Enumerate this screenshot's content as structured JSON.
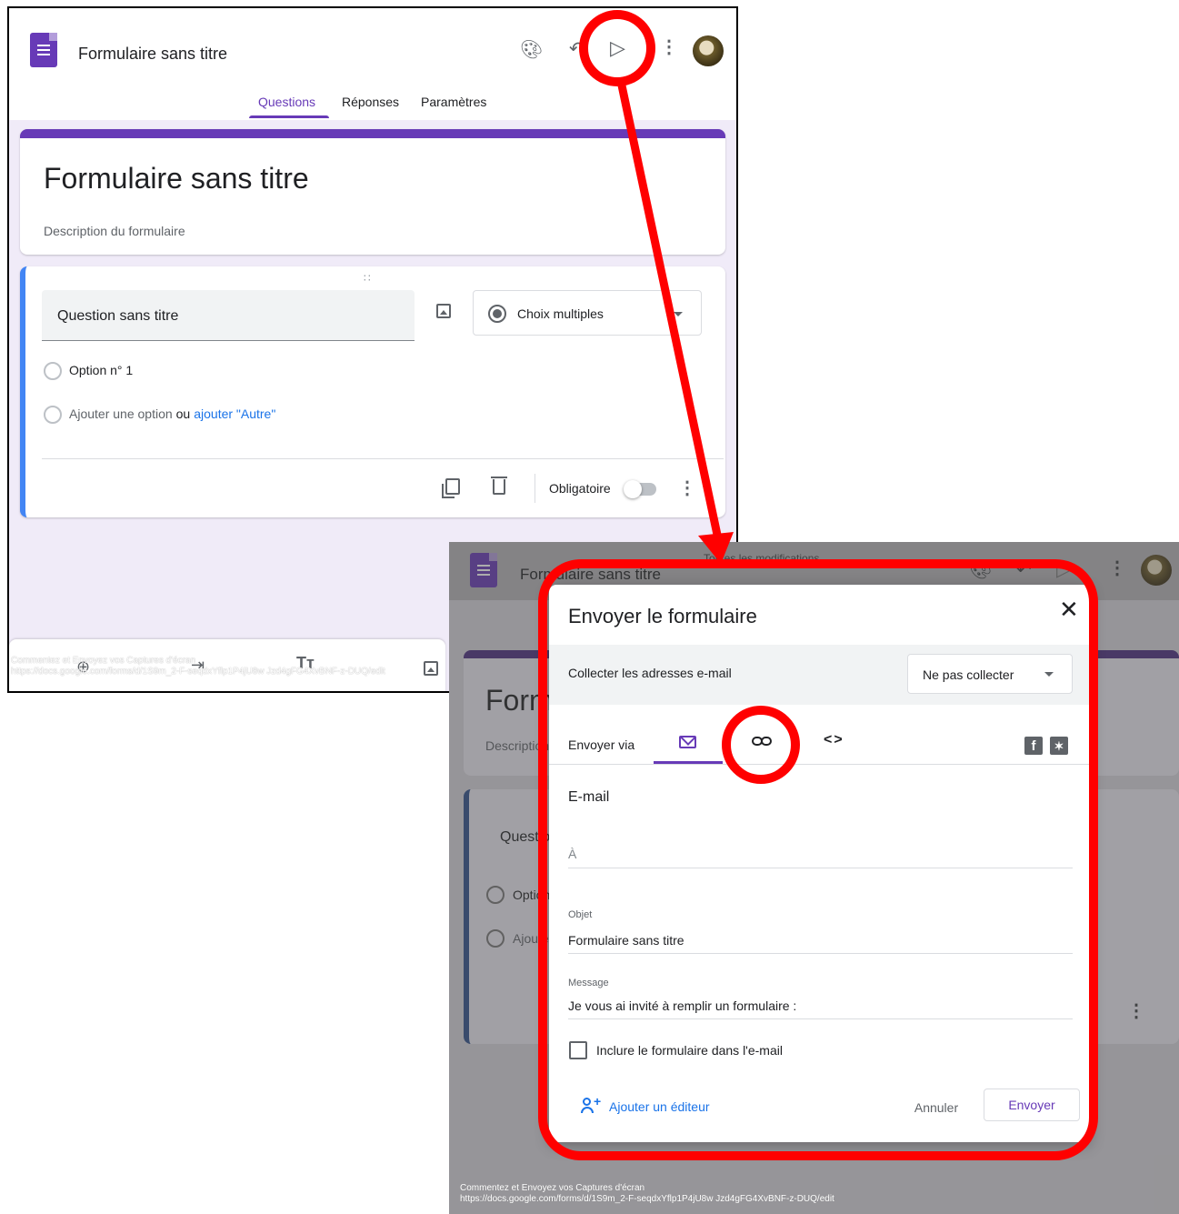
{
  "top_screen": {
    "app_title": "Formulaire sans titre",
    "tabs": [
      "Questions",
      "Réponses",
      "Paramètres"
    ],
    "form_title": "Formulaire sans titre",
    "form_description": "Description du formulaire",
    "question": {
      "title": "Question sans titre",
      "type": "Choix multiples",
      "option_1": "Option n° 1",
      "add_option": "Ajouter une option",
      "or": "ou",
      "add_other": "ajouter \"Autre\""
    },
    "required_label": "Obligatoire",
    "watermark_line1": "Commentez et Envoyez vos Captures d'écran",
    "watermark_line2": "https://docs.google.com/forms/d/1S9m_2-F-seqdxYflp1P4jU8w Jzd4gFG4XvBNF-z-DUQ/edit"
  },
  "bottom_screen": {
    "app_title": "Formulaire sans titre",
    "saved_status": "Toutes les modifications",
    "bg_title": "Formulaire sans titre",
    "bg_desc": "Description du formulaire",
    "bg_question": "Question sans titre",
    "bg_option": "Option n° 1",
    "bg_add_option": "Ajouter une option",
    "dialog": {
      "title": "Envoyer le formulaire",
      "collect_label": "Collecter les adresses e-mail",
      "collect_value": "Ne pas collecter",
      "send_via": "Envoyer via",
      "email_heading": "E-mail",
      "to_placeholder": "À",
      "subject_label": "Objet",
      "subject_value": "Formulaire sans titre",
      "message_label": "Message",
      "message_value": "Je vous ai invité à remplir un formulaire :",
      "include_label": "Inclure le formulaire dans l'e-mail",
      "add_editor": "Ajouter un éditeur",
      "cancel": "Annuler",
      "send": "Envoyer"
    },
    "watermark_line1": "Commentez et Envoyez vos Captures d'écran",
    "watermark_line2": "https://docs.google.com/forms/d/1S9m_2-F-seqdxYflp1P4jU8w Jzd4gFG4XvBNF-z-DUQ/edit"
  },
  "colors": {
    "forms_purple": "#673ab7",
    "annotation_red": "#ff0000",
    "link_blue": "#1a73e8",
    "question_accent": "#4285f4"
  },
  "icons": [
    "forms-logo-icon",
    "palette-icon",
    "undo-icon",
    "send-icon",
    "more-vert-icon",
    "image-icon",
    "radio-icon",
    "copy-icon",
    "trash-icon",
    "mail-icon",
    "link-icon",
    "embed-icon",
    "facebook-icon",
    "twitter-icon",
    "close-icon",
    "add-person-icon"
  ]
}
